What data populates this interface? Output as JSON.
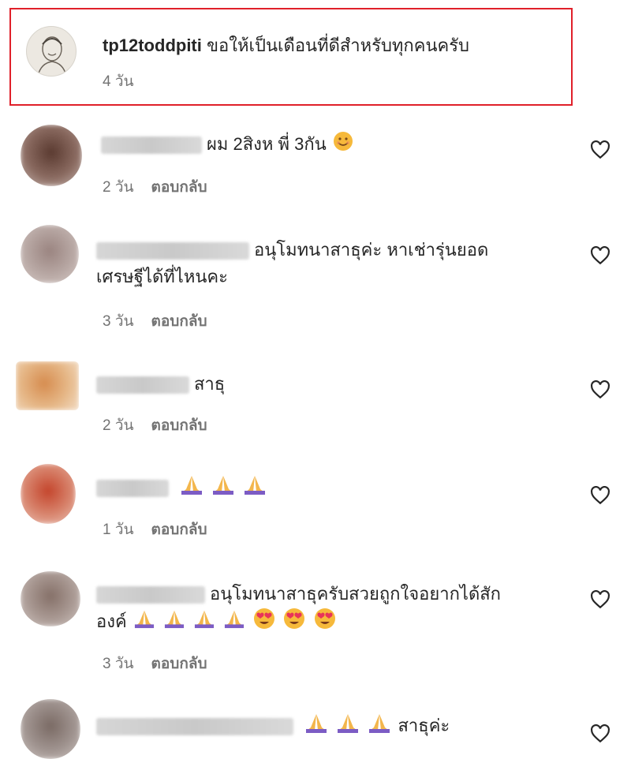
{
  "caption": {
    "username": "tp12toddpiti",
    "text": "ขอให้เป็นเดือนที่ดีสำหรับทุกคนครับ",
    "time": "4 วัน"
  },
  "comments": [
    {
      "text": "ผม 2สิงห พี่ 3กัน",
      "time": "2 วัน",
      "reply": "ตอบกลับ",
      "avatar_color": "#6b4a3e"
    },
    {
      "text": "อนุโมทนาสาธุค่ะ หาเช่ารุ่นยอด",
      "text2": "เศรษฐีได้ที่ไหนคะ",
      "time": "3 วัน",
      "reply": "ตอบกลับ",
      "avatar_color": "#a89690"
    },
    {
      "text": "สาธุ",
      "time": "2 วัน",
      "reply": "ตอบกลับ",
      "avatar_color": "#d9a06a"
    },
    {
      "text": "",
      "time": "1 วัน",
      "reply": "ตอบกลับ",
      "avatar_color": "#cf6a55"
    },
    {
      "text": "อนุโมทนาสาธุครับสวยถูกใจอยากได้สัก",
      "text2": "องค์",
      "time": "3 วัน",
      "reply": "ตอบกลับ",
      "avatar_color": "#9a8a82"
    },
    {
      "text": "สาธุค่ะ",
      "time": "",
      "reply": "",
      "avatar_color": "#8e7e78"
    }
  ],
  "icons": {
    "like": "heart-outline-icon",
    "pray": "folded-hands-emoji",
    "smile": "smiling-face-emoji",
    "heart_eyes": "heart-eyes-emoji"
  }
}
